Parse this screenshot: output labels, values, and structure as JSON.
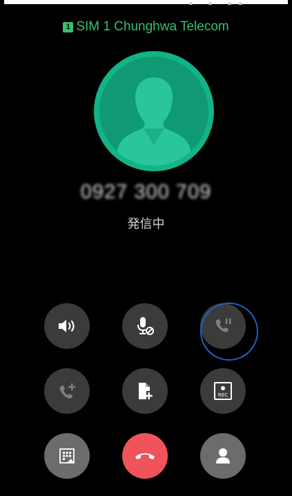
{
  "sim": {
    "badge": "1",
    "label": "SIM 1  Chunghwa Telecom"
  },
  "call": {
    "number": "0927 300 709",
    "status": "発信中"
  },
  "colors": {
    "accent": "#35c06e",
    "avatar": "#12b487",
    "end_call": "#f0545a",
    "focus_ring": "#1e60c8"
  },
  "buttons": {
    "speaker": {
      "icon": "speaker-icon"
    },
    "mute": {
      "icon": "mute-mic-icon"
    },
    "hold": {
      "icon": "hold-call-icon",
      "state": "disabled"
    },
    "add_call": {
      "icon": "add-call-icon",
      "state": "disabled"
    },
    "add_note": {
      "icon": "add-note-icon"
    },
    "record": {
      "icon": "record-icon",
      "label": "REC"
    },
    "dialpad": {
      "icon": "dialpad-icon"
    },
    "end_call": {
      "icon": "end-call-icon"
    },
    "contacts": {
      "icon": "contact-icon"
    }
  }
}
